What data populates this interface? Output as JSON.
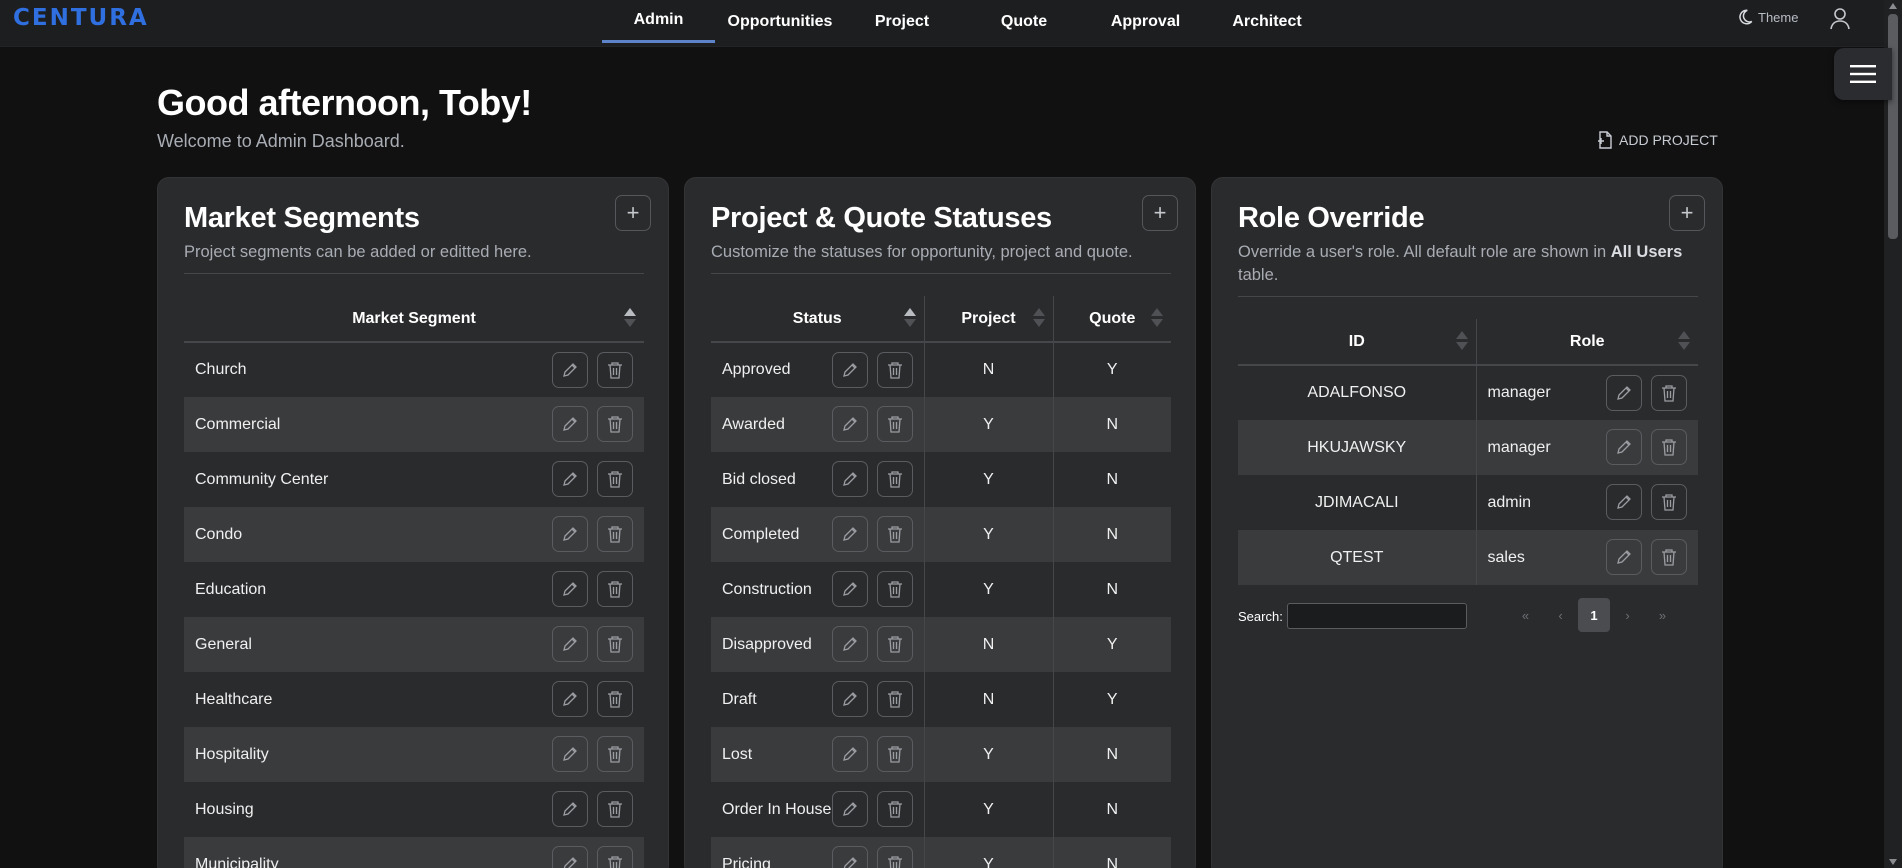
{
  "app": {
    "logo": "CENTURA"
  },
  "nav": {
    "tabs": [
      {
        "label": "Admin",
        "active": true
      },
      {
        "label": "Opportunities"
      },
      {
        "label": "Project"
      },
      {
        "label": "Quote"
      },
      {
        "label": "Approval"
      },
      {
        "label": "Architect"
      }
    ],
    "theme_label": "Theme"
  },
  "header": {
    "greeting": "Good afternoon, Toby!",
    "subtitle": "Welcome to Admin Dashboard.",
    "add_project_label": "ADD PROJECT"
  },
  "market_segments": {
    "title": "Market Segments",
    "subtitle": "Project segments can be added or editted here.",
    "column": "Market Segment",
    "rows": [
      "Church",
      "Commercial",
      "Community Center",
      "Condo",
      "Education",
      "General",
      "Healthcare",
      "Hospitality",
      "Housing",
      "Municipality"
    ]
  },
  "statuses": {
    "title": "Project & Quote Statuses",
    "subtitle": "Customize the statuses for opportunity, project and quote.",
    "columns": {
      "status": "Status",
      "project": "Project",
      "quote": "Quote"
    },
    "rows": [
      {
        "status": "Approved",
        "project": "N",
        "quote": "Y"
      },
      {
        "status": "Awarded",
        "project": "Y",
        "quote": "N"
      },
      {
        "status": "Bid closed",
        "project": "Y",
        "quote": "N"
      },
      {
        "status": "Completed",
        "project": "Y",
        "quote": "N"
      },
      {
        "status": "Construction",
        "project": "Y",
        "quote": "N"
      },
      {
        "status": "Disapproved",
        "project": "N",
        "quote": "Y"
      },
      {
        "status": "Draft",
        "project": "N",
        "quote": "Y"
      },
      {
        "status": "Lost",
        "project": "Y",
        "quote": "N"
      },
      {
        "status": "Order In House",
        "project": "Y",
        "quote": "N"
      },
      {
        "status": "Pricing",
        "project": "Y",
        "quote": "N"
      }
    ]
  },
  "role_override": {
    "title": "Role Override",
    "subtitle_pre": "Override a user's role. All default role are shown in ",
    "subtitle_bold": "All Users",
    "subtitle_post": " table.",
    "columns": {
      "id": "ID",
      "role": "Role"
    },
    "rows": [
      {
        "id": "ADALFONSO",
        "role": "manager"
      },
      {
        "id": "HKUJAWSKY",
        "role": "manager"
      },
      {
        "id": "JDIMACALI",
        "role": "admin"
      },
      {
        "id": "QTEST",
        "role": "sales"
      }
    ],
    "search_label": "Search:",
    "search_value": "",
    "pager": {
      "first": "«",
      "prev": "‹",
      "current": "1",
      "next": "›",
      "last": "»"
    }
  },
  "colors": {
    "brand": "#2f6fe0",
    "active_tab_underline": "#5d84c9",
    "card_bg": "#2a2b2d",
    "row_alt": "#3a3b3d"
  }
}
